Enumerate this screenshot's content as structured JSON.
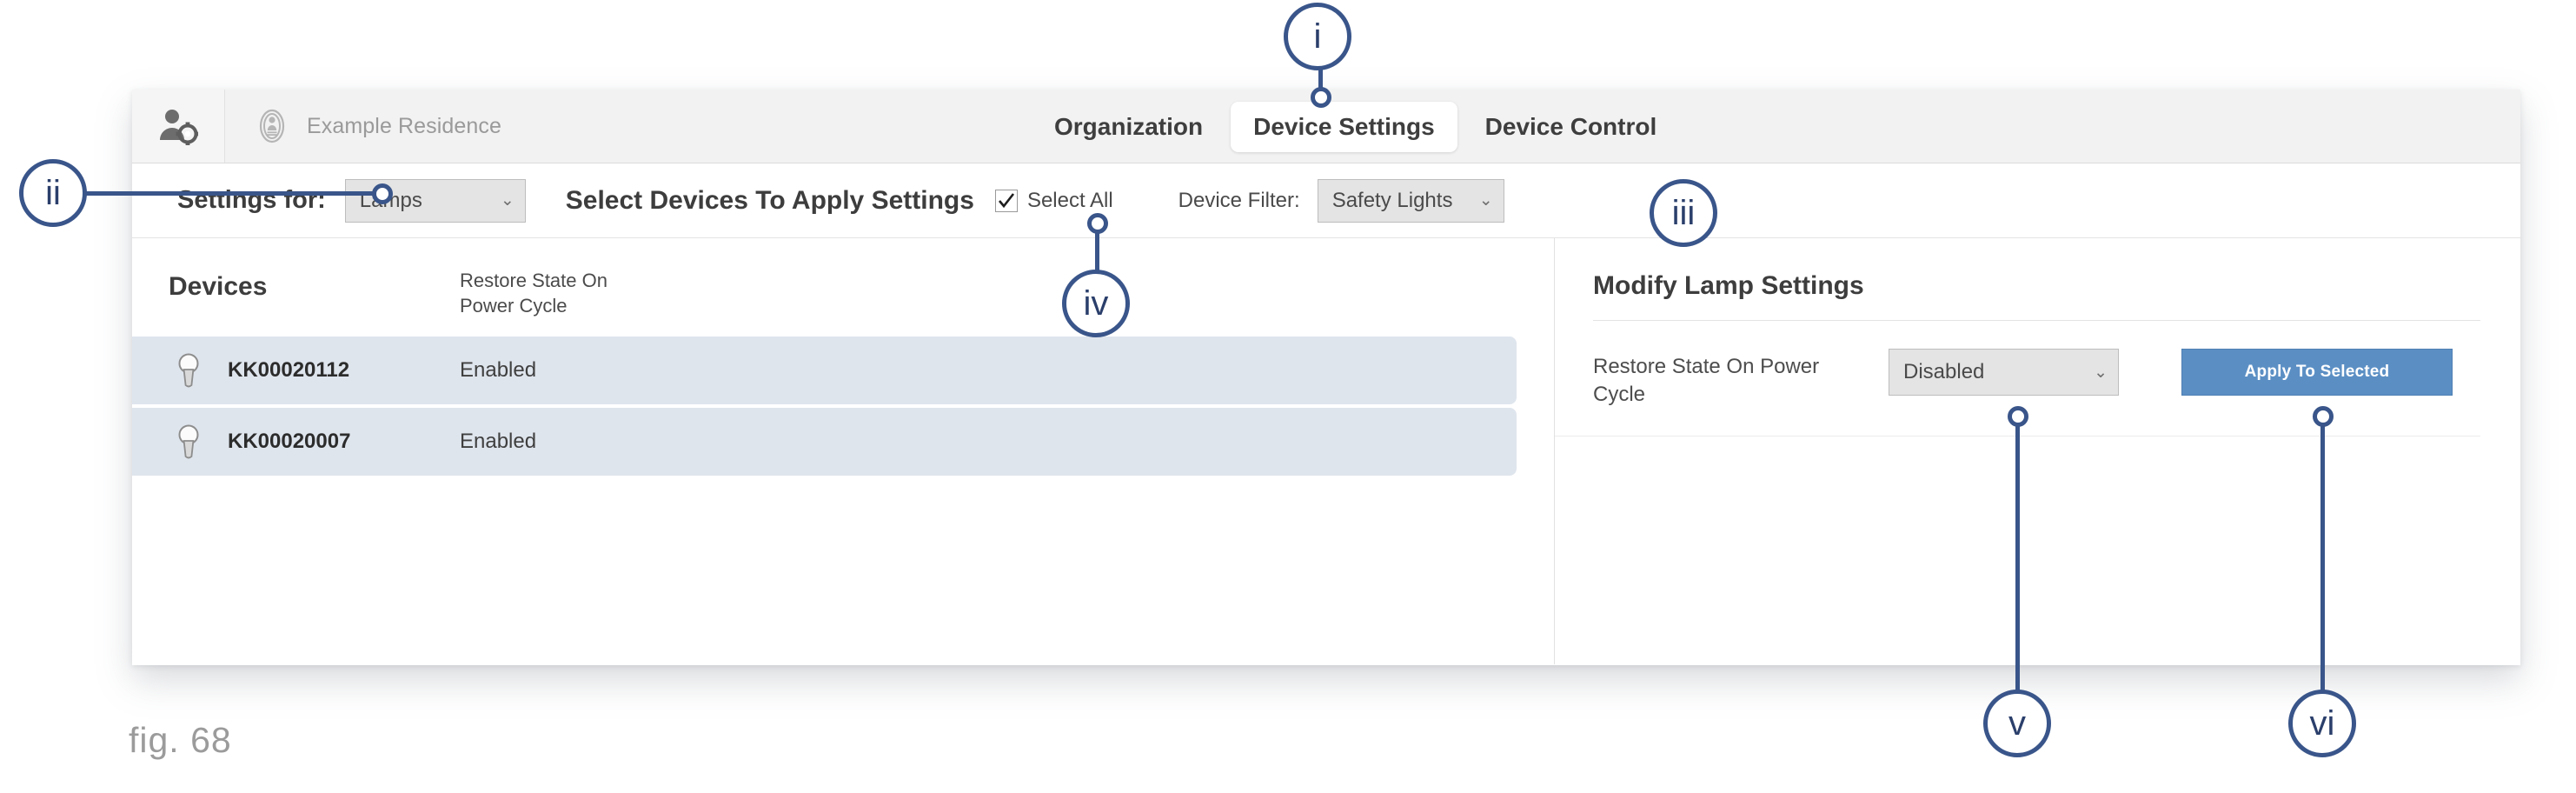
{
  "figure": {
    "caption": "fig. 68"
  },
  "window": {
    "topbar": {
      "user_icon": "user-gear-icon",
      "org_icon": "organization-badge-icon",
      "org_name": "Example Residence",
      "tabs": [
        {
          "label": "Organization",
          "active": false
        },
        {
          "label": "Device Settings",
          "active": true
        },
        {
          "label": "Device Control",
          "active": false
        }
      ]
    },
    "settings_bar": {
      "settings_for_label": "Settings for:",
      "settings_for_value": "Lamps",
      "headline": "Select Devices To Apply Settings",
      "select_all_label": "Select All",
      "select_all_checked": true,
      "device_filter_label": "Device Filter:",
      "device_filter_value": "Safety Lights"
    },
    "devices_table": {
      "columns": [
        "Devices",
        "Restore State On\nPower Cycle"
      ],
      "col_devices": "Devices",
      "col_restore_line1": "Restore State On",
      "col_restore_line2": "Power Cycle",
      "rows": [
        {
          "icon": "lamp-bulb-icon",
          "id": "KK00020112",
          "restore_state": "Enabled",
          "selected": true
        },
        {
          "icon": "lamp-bulb-icon",
          "id": "KK00020007",
          "restore_state": "Enabled",
          "selected": true
        }
      ]
    },
    "modify_panel": {
      "title": "Modify Lamp Settings",
      "field_label_line1": "Restore State On Power",
      "field_label_line2": "Cycle",
      "field_value": "Disabled",
      "apply_button": "Apply To Selected"
    }
  },
  "callouts": [
    {
      "id": "i",
      "label": "i"
    },
    {
      "id": "ii",
      "label": "ii"
    },
    {
      "id": "iii",
      "label": "iii"
    },
    {
      "id": "iv",
      "label": "iv"
    },
    {
      "id": "v",
      "label": "v"
    },
    {
      "id": "vi",
      "label": "vi"
    }
  ],
  "colors": {
    "callout_blue": "#39558a",
    "tab_active_bg": "#ffffff",
    "row_selected_bg": "#dfe5ed",
    "apply_button_bg": "#5b8fc4",
    "topbar_bg": "#f2f2f2",
    "select_bg": "#e4e4e4",
    "caption_grey": "#9b9b9b"
  }
}
